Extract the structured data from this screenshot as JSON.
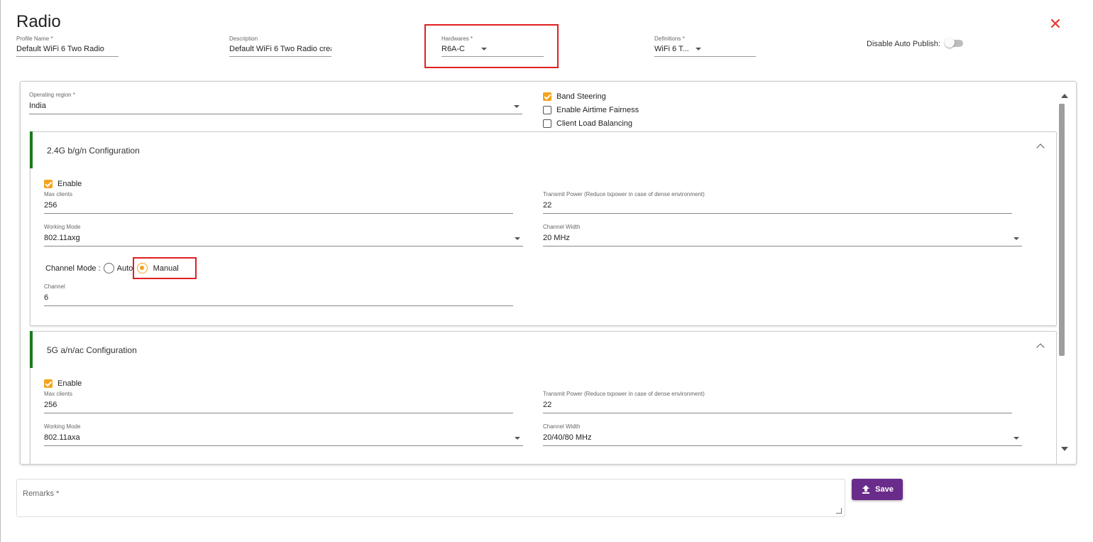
{
  "dialog": {
    "title": "Radio",
    "close_icon": "close-icon"
  },
  "header": {
    "profile_name": {
      "label": "Profile Name *",
      "value": "Default WiFi 6 Two Radio"
    },
    "description": {
      "label": "Description",
      "value": "Default WiFi 6 Two Radio crea"
    },
    "hardwares": {
      "label": "Hardwares *",
      "value": "R6A-C"
    },
    "definitions": {
      "label": "Definitions *",
      "value": "WiFi 6 T..."
    },
    "auto_publish": {
      "label": "Disable Auto Publish:",
      "on": false
    }
  },
  "general": {
    "operating_region": {
      "label": "Operating region *",
      "value": "India"
    },
    "band_steering": {
      "label": "Band Steering",
      "checked": true
    },
    "airtime_fairness": {
      "label": "Enable Airtime Fairness",
      "checked": false
    },
    "load_balancing": {
      "label": "Client Load Balancing",
      "checked": false
    }
  },
  "band24": {
    "title": "2.4G b/g/n Configuration",
    "enable": {
      "label": "Enable",
      "checked": true
    },
    "max_clients": {
      "label": "Max clients",
      "value": "256"
    },
    "transmit_power": {
      "label": "Transmit Power (Reduce txpower in case of dense environment)",
      "value": "22"
    },
    "working_mode": {
      "label": "Working Mode",
      "value": "802.11axg"
    },
    "channel_width": {
      "label": "Channel Width",
      "value": "20 MHz"
    },
    "channel_mode": {
      "label": "Channel Mode :",
      "auto": "Auto",
      "manual": "Manual",
      "selected": "Manual"
    },
    "channel": {
      "label": "Channel",
      "value": "6"
    }
  },
  "band5": {
    "title": "5G a/n/ac Configuration",
    "enable": {
      "label": "Enable",
      "checked": true
    },
    "max_clients": {
      "label": "Max clients",
      "value": "256"
    },
    "transmit_power": {
      "label": "Transmit Power (Reduce txpower in case of dense environment)",
      "value": "22"
    },
    "working_mode": {
      "label": "Working Mode",
      "value": "802.11axa"
    },
    "channel_width": {
      "label": "Channel Width",
      "value": "20/40/80 MHz"
    }
  },
  "footer": {
    "remarks_placeholder": "Remarks *",
    "save_label": "Save"
  },
  "colors": {
    "accent": "#f5a21b",
    "save": "#6a2c8a",
    "section_bar": "#1b7a1b",
    "highlight": "#e02020",
    "close": "#e53935"
  }
}
